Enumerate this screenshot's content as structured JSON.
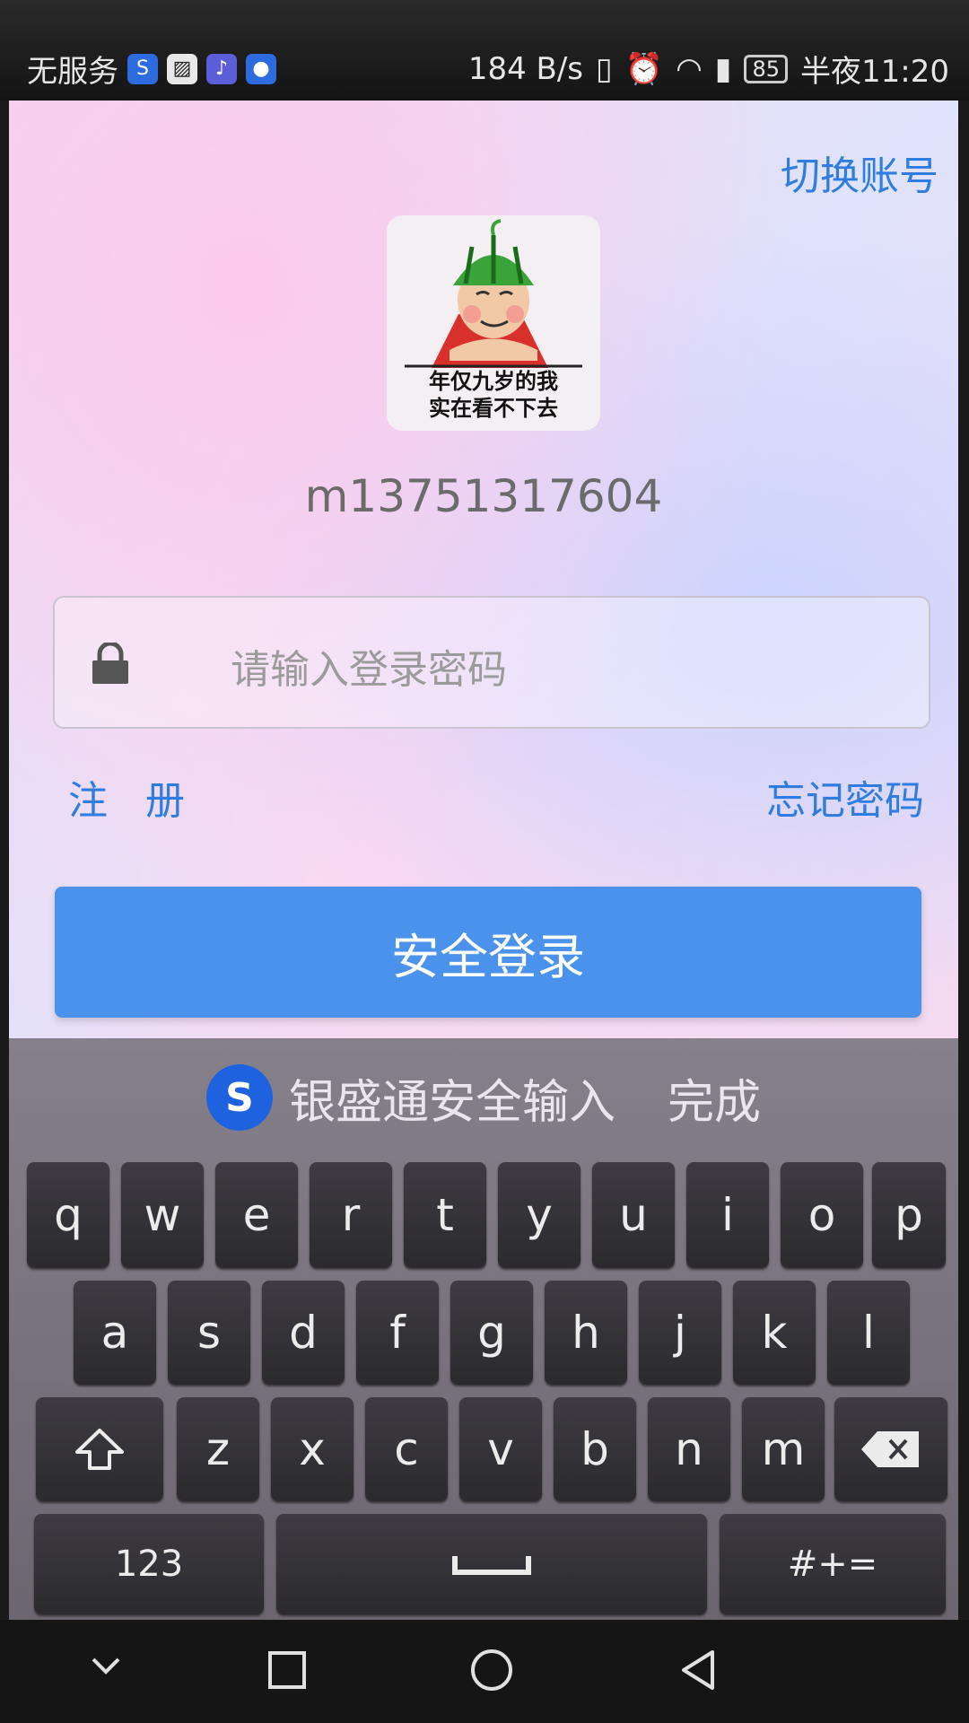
{
  "status_bar": {
    "carrier": "无服务",
    "net_speed": "184 B/s",
    "battery": "85",
    "time": "半夜11:20"
  },
  "header": {
    "switch_account": "切换账号"
  },
  "avatar": {
    "line1": "年仅九岁的我",
    "line2": "实在看不下去"
  },
  "account": {
    "username": "m13751317604"
  },
  "password": {
    "placeholder": "请输入登录密码"
  },
  "links": {
    "register": "注 册",
    "forgot": "忘记密码"
  },
  "login_button": "安全登录",
  "keyboard": {
    "title": "银盛通安全输入",
    "done": "完成",
    "row1": [
      "q",
      "w",
      "e",
      "r",
      "t",
      "y",
      "u",
      "i",
      "o",
      "p"
    ],
    "row2": [
      "a",
      "s",
      "d",
      "f",
      "g",
      "h",
      "j",
      "k",
      "l"
    ],
    "row3": [
      "z",
      "x",
      "c",
      "v",
      "b",
      "n",
      "m"
    ],
    "numbers_key": "123",
    "symbols_key": "#+="
  },
  "colors": {
    "accent": "#2f7de1",
    "button": "#4a92ec",
    "keyboard_logo": "#1f62e0"
  }
}
